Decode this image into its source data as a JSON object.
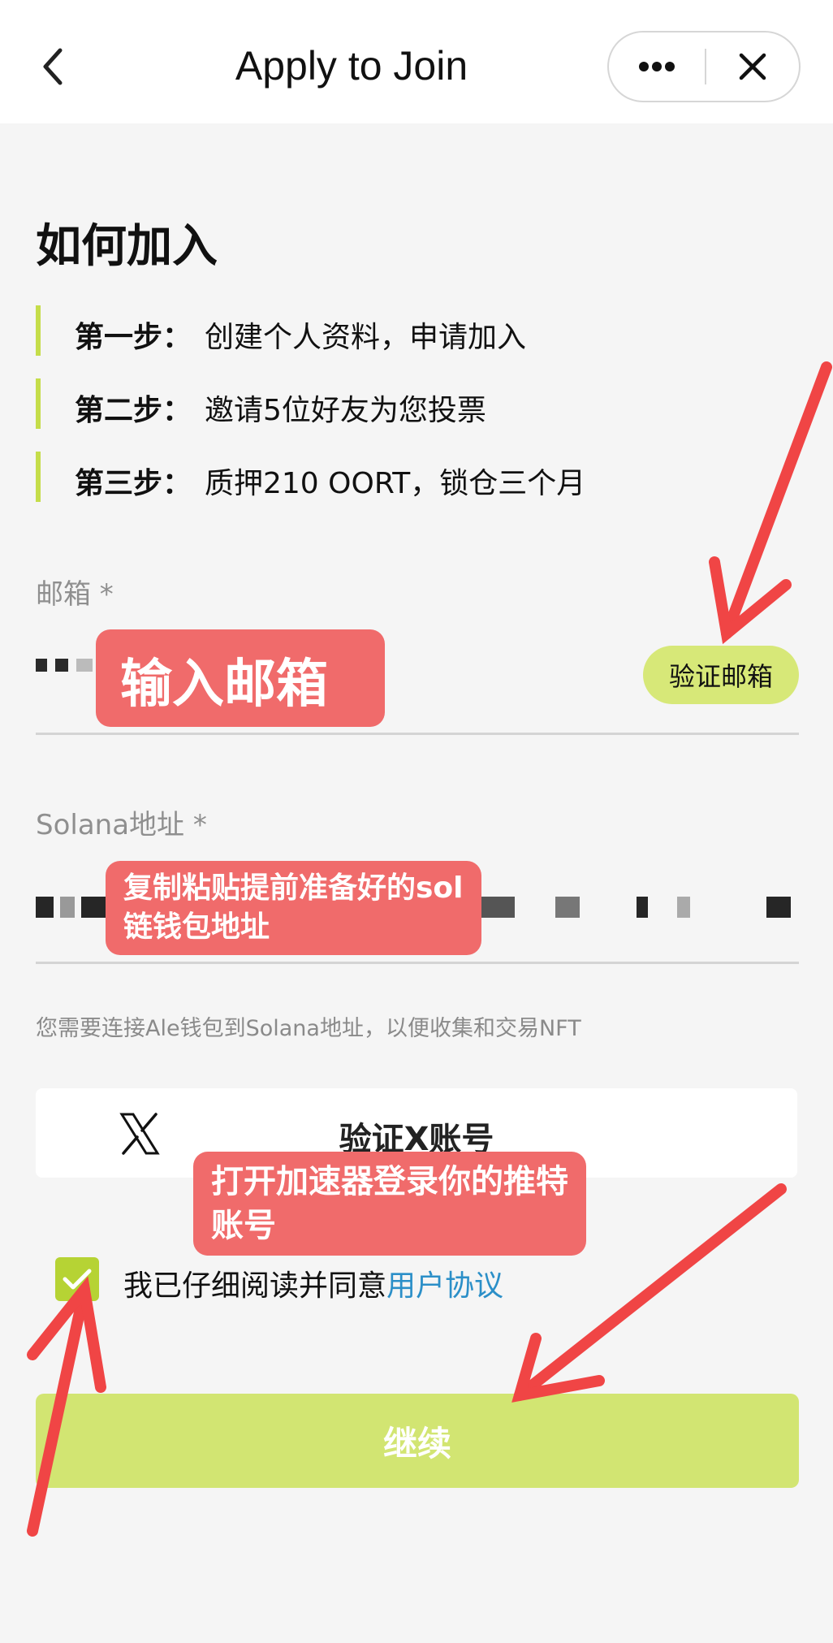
{
  "header": {
    "title": "Apply to Join"
  },
  "join": {
    "title": "如何加入",
    "steps": [
      {
        "label": "第一步：",
        "text": "创建个人资料，申请加入"
      },
      {
        "label": "第二步：",
        "text": "邀请5位好友为您投票"
      },
      {
        "label": "第三步：",
        "text": "质押210 OORT，锁仓三个月"
      }
    ]
  },
  "email": {
    "label": "邮箱 *",
    "verify_button": "验证邮箱"
  },
  "solana": {
    "label": "Solana地址 *",
    "hint": "您需要连接Ale钱包到Solana地址，以便收集和交易NFT"
  },
  "x_verify": {
    "label": "验证X账号"
  },
  "agreement": {
    "text": "我已仔细阅读并同意",
    "link": "用户协议",
    "checked": true
  },
  "continue_button": "继续",
  "annotations": {
    "email_note": "输入邮箱",
    "sol_note_line1": "复制粘贴提前准备好的sol",
    "sol_note_line2": "链钱包地址",
    "x_note_line1": "打开加速器登录你的推特",
    "x_note_line2": "账号"
  },
  "colors": {
    "accent": "#c5dd4a",
    "button": "#d2e572",
    "link": "#2b8fc8",
    "annotation": "#f06b6b",
    "arrow": "#f04545"
  }
}
